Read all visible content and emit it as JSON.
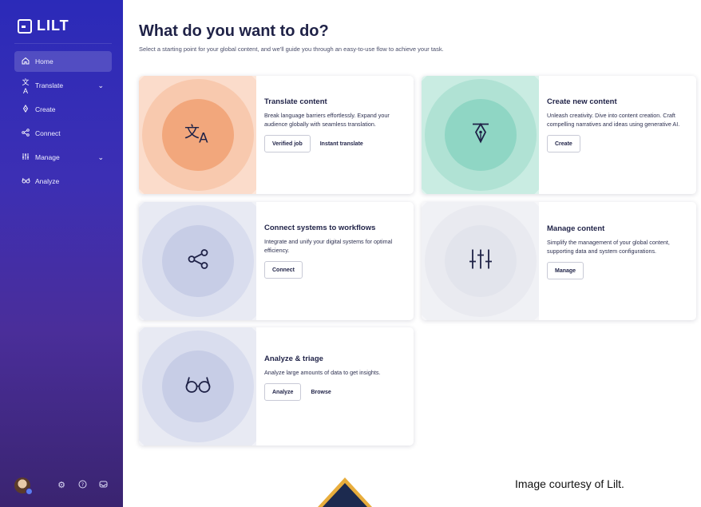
{
  "brand": {
    "logo_text": "LILT"
  },
  "sidebar": {
    "items": [
      {
        "label": "Home",
        "icon": "home-icon",
        "active": true
      },
      {
        "label": "Translate",
        "icon": "translate-icon",
        "expandable": true
      },
      {
        "label": "Create",
        "icon": "pen-icon"
      },
      {
        "label": "Connect",
        "icon": "share-icon"
      },
      {
        "label": "Manage",
        "icon": "sliders-icon",
        "expandable": true
      },
      {
        "label": "Analyze",
        "icon": "glasses-icon"
      }
    ],
    "bottom_icons": [
      "avatar",
      "gear-icon",
      "help-icon",
      "inbox-icon"
    ]
  },
  "main": {
    "title": "What do you want to do?",
    "subtitle": "Select a starting point for your global content, and we'll guide you through an easy-to-use flow to achieve your task."
  },
  "cards": [
    {
      "title": "Translate content",
      "desc": "Break language barriers effortlessly. Expand your audience globally with seamless translation.",
      "button": "Verified job",
      "link": "Instant translate",
      "icon": "translate-icon"
    },
    {
      "title": "Create new content",
      "desc": "Unleash creativity. Dive into content creation. Craft compelling narratives and ideas using generative AI.",
      "button": "Create",
      "icon": "pen-nib-icon"
    },
    {
      "title": "Connect systems to workflows",
      "desc": "Integrate and unify your digital systems for optimal efficiency.",
      "button": "Connect",
      "icon": "share-icon"
    },
    {
      "title": "Manage content",
      "desc": "Simplify the management of your global content, supporting data and system configurations.",
      "button": "Manage",
      "icon": "sliders-icon"
    },
    {
      "title": "Analyze & triage",
      "desc": "Analyze large amounts of data to get insights.",
      "button": "Analyze",
      "link": "Browse",
      "icon": "glasses-icon"
    }
  ],
  "credit": "Image courtesy of Lilt.",
  "colors": {
    "sidebar_top": "#2b2ab8",
    "sidebar_bottom": "#3a2470",
    "translate_accent": "#f2a77c",
    "create_accent": "#8fd6c4",
    "neutral_accent": "#c7cde6",
    "bottom_tri_border": "#e8ad3c",
    "bottom_tri_fill": "#1c2a4f"
  }
}
